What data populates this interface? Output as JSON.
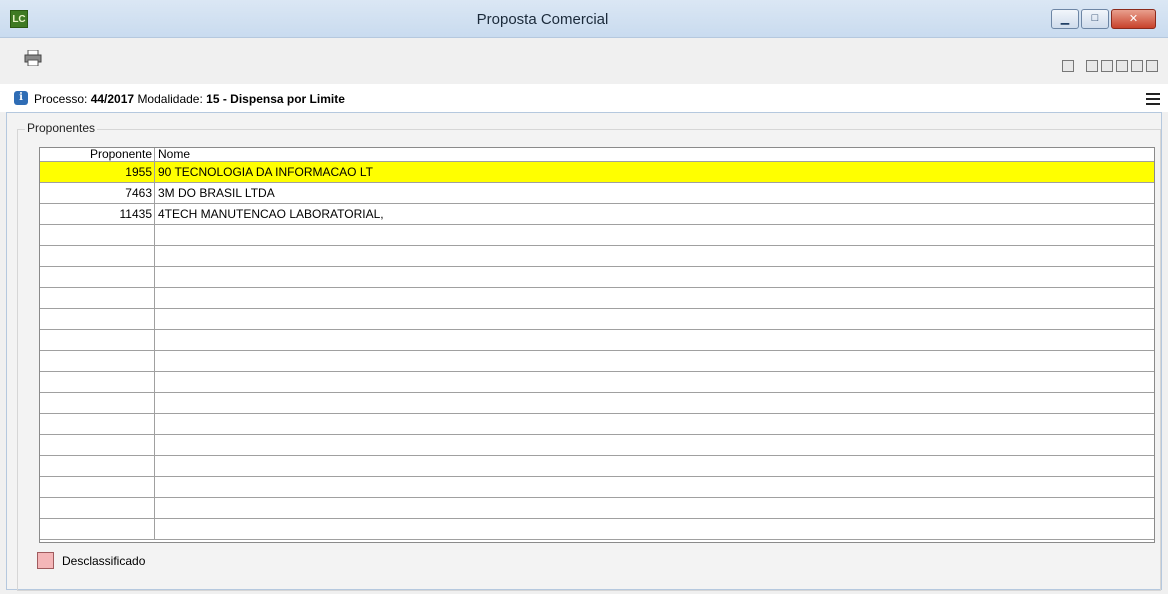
{
  "window": {
    "app_icon_text": "LC",
    "title": "Proposta Comercial",
    "minimize": "▁",
    "maximize": "□",
    "close": "✕"
  },
  "toolbar": {
    "print_icon": "printer-icon"
  },
  "info": {
    "processo_label": "Processo:",
    "processo_value": "44/2017",
    "modalidade_label": "Modalidade:",
    "modalidade_value": "15 - Dispensa por Limite"
  },
  "group": {
    "label": "Proponentes"
  },
  "grid": {
    "columns": [
      "Proponente",
      "Nome"
    ],
    "rows": [
      {
        "id": "1955",
        "nome": "90 TECNOLOGIA DA INFORMACAO LT",
        "highlighted": true
      },
      {
        "id": "7463",
        "nome": "3M DO BRASIL LTDA",
        "highlighted": false
      },
      {
        "id": "11435",
        "nome": "4TECH MANUTENCAO LABORATORIAL,",
        "highlighted": false
      }
    ],
    "empty_rows": 15,
    "highlight_color": "#ffff00"
  },
  "legend": {
    "label": "Desclassificado",
    "color": "#f4b6b8"
  }
}
